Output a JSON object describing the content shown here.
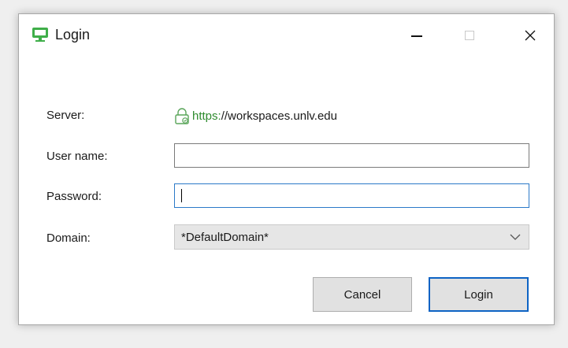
{
  "window": {
    "title": "Login",
    "accent_color": "#2e8b2e",
    "focus_color": "#0d63c4"
  },
  "form": {
    "server_label": "Server:",
    "server_scheme": "https:",
    "server_rest": "//workspaces.unlv.edu",
    "username_label": "User name:",
    "username_value": "",
    "password_label": "Password:",
    "password_value": "",
    "domain_label": "Domain:",
    "domain_value": "*DefaultDomain*"
  },
  "buttons": {
    "cancel": "Cancel",
    "login": "Login"
  },
  "icons": {
    "app": "monitor-icon",
    "lock": "lock-icon",
    "dropdown": "chevron-down-icon"
  }
}
